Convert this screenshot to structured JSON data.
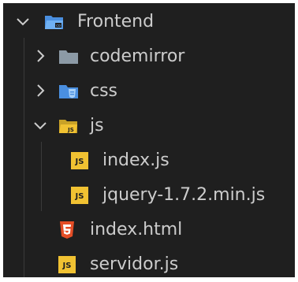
{
  "explorer": {
    "root": {
      "label": "Frontend",
      "icon": "folder-open-icon",
      "expanded": true
    },
    "items": [
      {
        "label": "codemirror",
        "type": "folder",
        "icon": "folder-icon",
        "expanded": false
      },
      {
        "label": "css",
        "type": "folder",
        "icon": "css-folder-icon",
        "expanded": false
      },
      {
        "label": "js",
        "type": "folder",
        "icon": "js-folder-open-icon",
        "expanded": true,
        "children": [
          {
            "label": "index.js",
            "type": "file",
            "icon": "js-file-icon"
          },
          {
            "label": "jquery-1.7.2.min.js",
            "type": "file",
            "icon": "js-file-icon"
          }
        ]
      },
      {
        "label": "index.html",
        "type": "file",
        "icon": "html5-file-icon"
      },
      {
        "label": "servidor.js",
        "type": "file",
        "icon": "js-file-icon"
      }
    ],
    "colors": {
      "background": "#1f1f1f",
      "text": "#cccccc",
      "folder_grey": "#8c9aa6",
      "folder_blue": "#4a8fe0",
      "js_yellow": "#f1c232",
      "html_orange": "#e44d26"
    }
  }
}
